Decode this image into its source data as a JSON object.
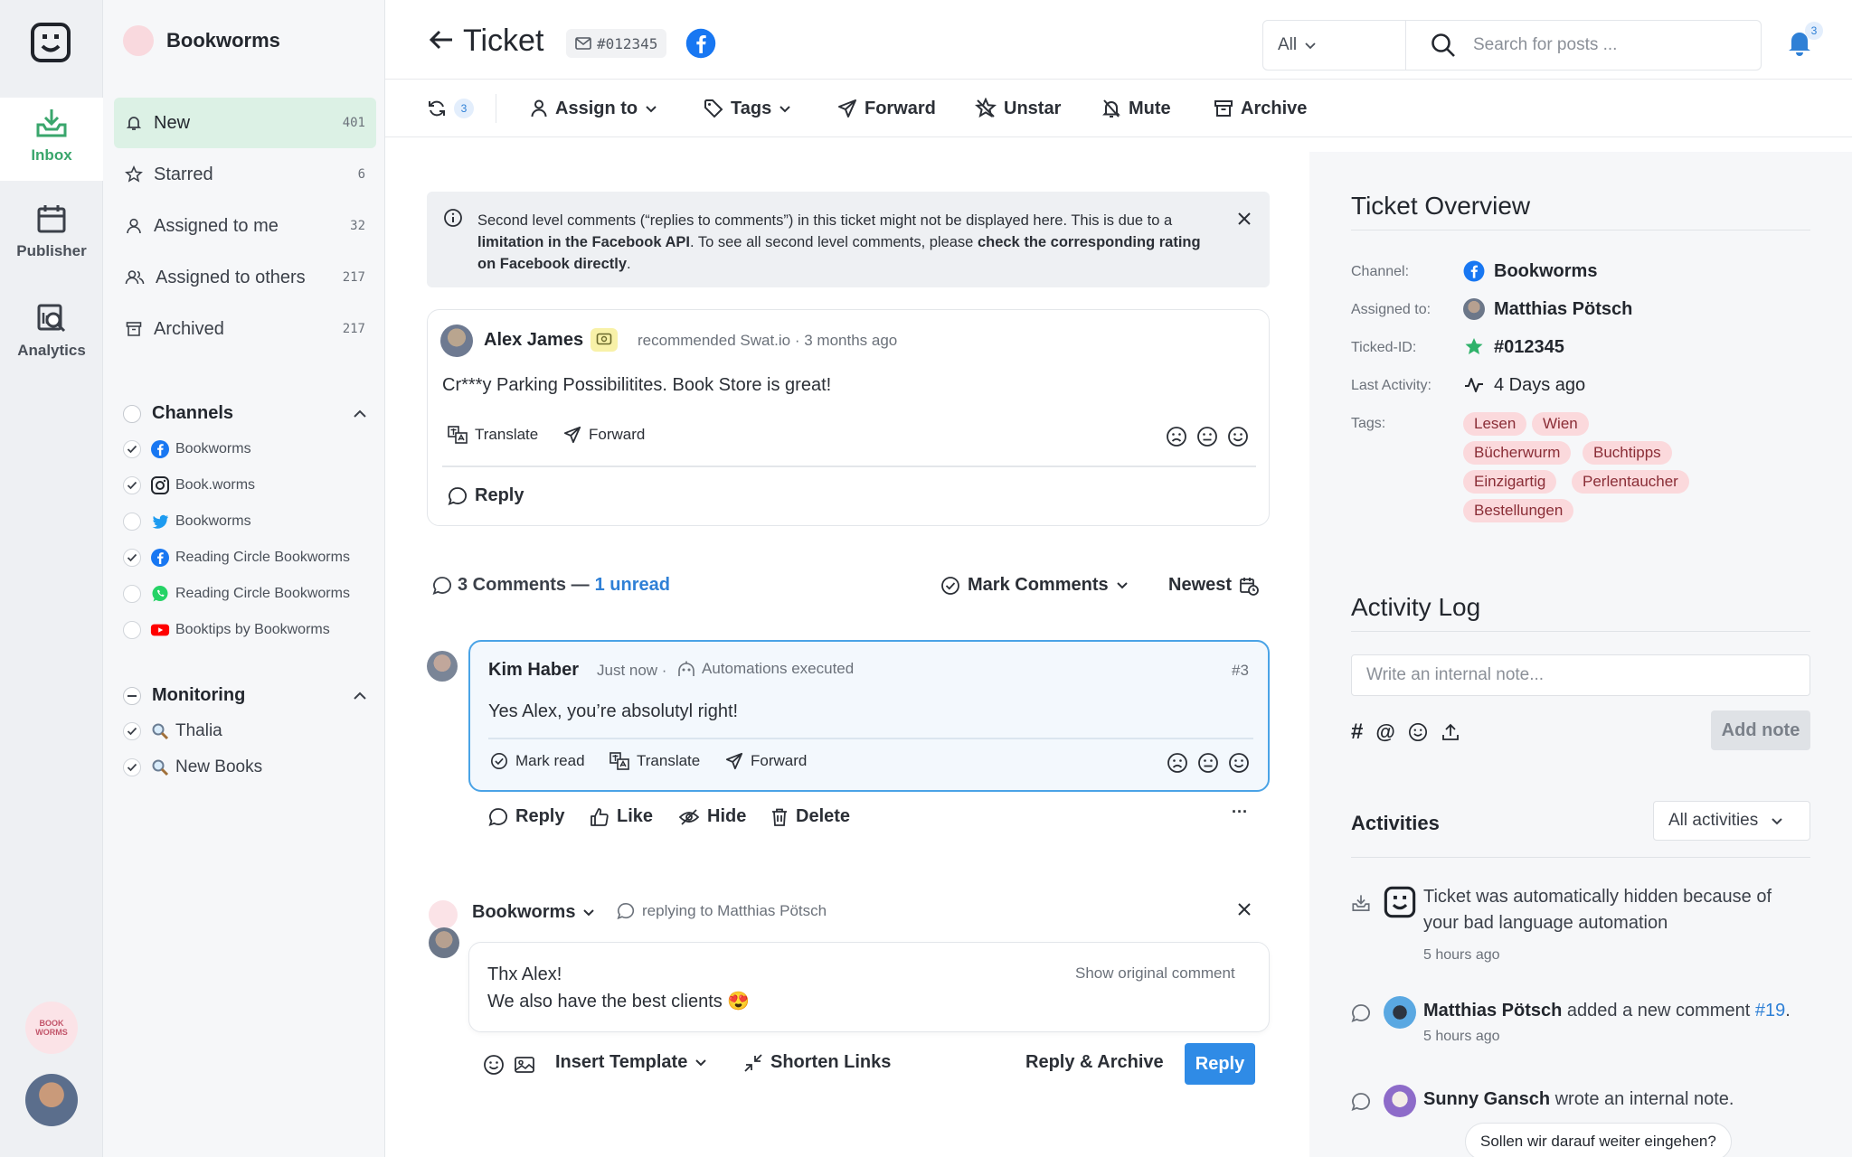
{
  "rail": {
    "items": [
      {
        "label": "Inbox"
      },
      {
        "label": "Publisher"
      },
      {
        "label": "Analytics"
      }
    ],
    "brand_avatar_text": "BOOK WORMS"
  },
  "sidebar": {
    "brand": "Bookworms",
    "nav": [
      {
        "label": "New",
        "count": "401"
      },
      {
        "label": "Starred",
        "count": "6"
      },
      {
        "label": "Assigned to me",
        "count": "32"
      },
      {
        "label": "Assigned to others",
        "count": "217"
      },
      {
        "label": "Archived",
        "count": "217"
      }
    ],
    "channels_title": "Channels",
    "channels": [
      {
        "label": "Bookworms",
        "network": "facebook"
      },
      {
        "label": "Book.worms",
        "network": "instagram"
      },
      {
        "label": "Bookworms",
        "network": "twitter"
      },
      {
        "label": "Reading Circle Bookworms",
        "network": "facebook"
      },
      {
        "label": "Reading Circle Bookworms",
        "network": "whatsapp"
      },
      {
        "label": "Booktips by Bookworms",
        "network": "youtube"
      }
    ],
    "monitoring_title": "Monitoring",
    "monitoring": [
      {
        "label": "Thalia"
      },
      {
        "label": "New Books"
      }
    ]
  },
  "header": {
    "title": "Ticket",
    "ticket_id": "#012345",
    "filter": "All",
    "search_placeholder": "Search for posts ...",
    "notifications": "3"
  },
  "toolbar": {
    "sync_count": "3",
    "assign": "Assign to",
    "tags": "Tags",
    "forward": "Forward",
    "unstar": "Unstar",
    "mute": "Mute",
    "archive": "Archive"
  },
  "info": {
    "t1": "Second level comments (“replies to comments”) in this ticket might not be displayed here. This is due to a ",
    "b1": "limitation in the Facebook API",
    "t2": ". To see all second level comments, please ",
    "b2": "check the corresponding rating on Facebook directly",
    "t3": "."
  },
  "post": {
    "author": "Alex James",
    "meta": "recommended Swat.io · 3 months ago",
    "text": "Cr***y Parking Possibilitites. Book Store is great!",
    "translate": "Translate",
    "forward": "Forward",
    "reply": "Reply"
  },
  "comments": {
    "count_label": "3 Comments —",
    "unread_label": "1 unread",
    "mark": "Mark Comments",
    "sort": "Newest"
  },
  "comment": {
    "author": "Kim Haber",
    "time": "Just now ·",
    "automation": "Automations executed",
    "number": "#3",
    "text": "Yes Alex, you’re absolutyl right!",
    "mark_read": "Mark read",
    "translate": "Translate",
    "forward": "Forward",
    "reply": "Reply",
    "like": "Like",
    "hide": "Hide",
    "delete": "Delete",
    "more": "···"
  },
  "composer": {
    "account": "Bookworms",
    "replying_to": "replying to Matthias Pötsch",
    "line1": "Thx Alex!",
    "line2": "We also have the best clients 😍",
    "show_original": "Show original comment",
    "insert_template": "Insert Template",
    "shorten": "Shorten Links",
    "reply_archive": "Reply & Archive",
    "reply": "Reply"
  },
  "overview": {
    "title": "Ticket Overview",
    "channel_label": "Channel:",
    "channel": "Bookworms",
    "assigned_label": "Assigned to:",
    "assigned": "Matthias Pötsch",
    "ticket_label": "Ticked-ID:",
    "ticket": "#012345",
    "activity_label": "Last Activity:",
    "activity": "4 Days ago",
    "tags_label": "Tags:",
    "tags": [
      "Lesen",
      "Wien",
      "Bücherwurm",
      "Buchtipps",
      "Einzigartig",
      "Perlentaucher",
      "Bestellungen"
    ]
  },
  "activity_log": {
    "title": "Activity Log",
    "placeholder": "Write an internal note...",
    "add_note": "Add note",
    "activities_title": "Activities",
    "filter": "All activities",
    "items": [
      {
        "text": "Ticket was automatically hidden because of your bad language automation",
        "time": "5 hours ago"
      },
      {
        "name": "Matthias Pötsch",
        "text": " added a new comment ",
        "link": "#19",
        "end": ".",
        "time": "5 hours ago"
      },
      {
        "name": "Sunny Gansch",
        "text": " wrote an internal note.",
        "note": "Sollen wir darauf weiter eingehen?"
      }
    ]
  },
  "colors": {
    "accent_green": "#3aa66c",
    "link_blue": "#2f80d6",
    "facebook": "#1877f2",
    "tag_bg": "#fbd9dc",
    "reply_button": "#2f8be6"
  }
}
